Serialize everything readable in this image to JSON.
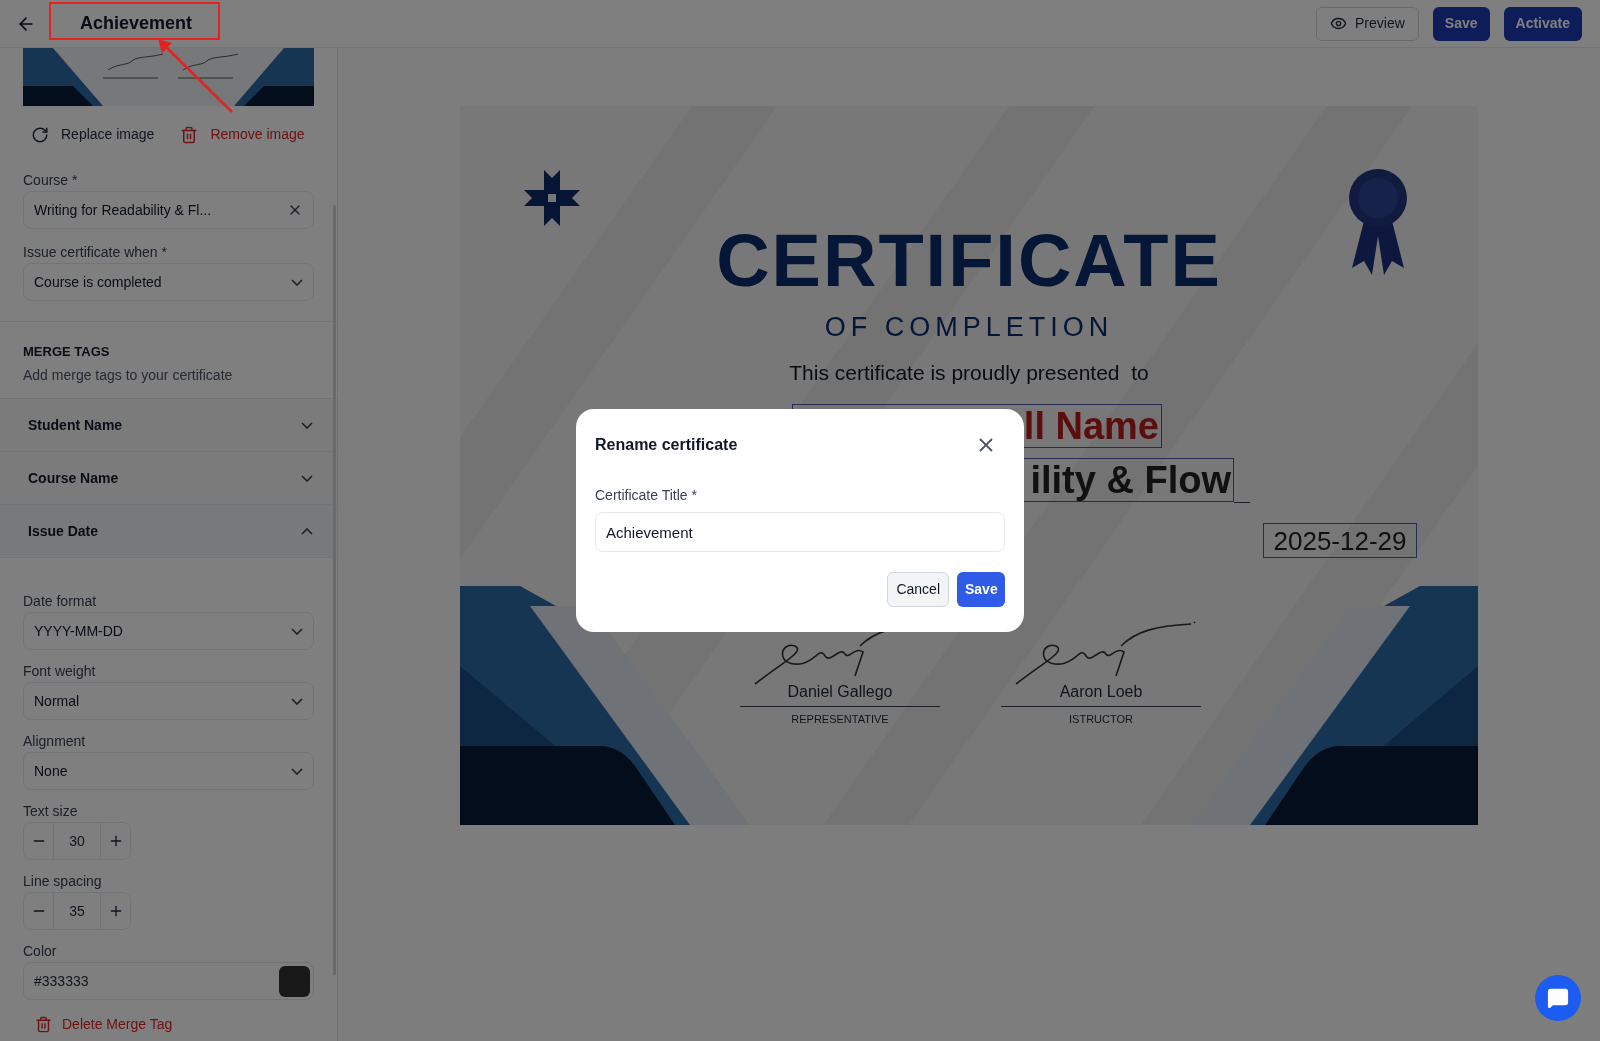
{
  "header": {
    "title": "Achievement",
    "actions": [
      {
        "label": "Preview",
        "kind": "outline"
      },
      {
        "label": "Save",
        "kind": "primary"
      },
      {
        "label": "Activate",
        "kind": "primary"
      }
    ]
  },
  "sidebar": {
    "image_actions": [
      {
        "label": "Replace image",
        "kind": "replace"
      },
      {
        "label": "Remove image",
        "kind": "remove"
      }
    ],
    "fields": [
      {
        "label": "Course *",
        "kind": "clearable",
        "value": "Writing for Readability & Fl..."
      },
      {
        "label": "Issue certificate when *",
        "kind": "select",
        "value": "Course is completed"
      }
    ],
    "merge_tags": {
      "title": "MERGE TAGS",
      "subtitle": "Add merge tags to your certificate",
      "items": [
        {
          "label": "Student Name",
          "expanded": false
        },
        {
          "label": "Course Name",
          "expanded": false
        },
        {
          "label": "Issue Date",
          "expanded": true,
          "settings": [
            {
              "label": "Date format",
              "kind": "select",
              "value": "YYYY-MM-DD"
            },
            {
              "label": "Font weight",
              "kind": "select",
              "value": "Normal"
            },
            {
              "label": "Alignment",
              "kind": "select",
              "value": "None"
            },
            {
              "label": "Text size",
              "kind": "stepper",
              "value": "30"
            },
            {
              "label": "Line spacing",
              "kind": "stepper",
              "value": "35"
            },
            {
              "label": "Color",
              "kind": "color",
              "value": "#333333"
            }
          ],
          "delete_label": "Delete Merge Tag"
        }
      ]
    }
  },
  "certificate": {
    "title": "CERTIFICATE",
    "subtitle": "OF COMPLETION",
    "presented": "This certificate is proudly presented  to",
    "student_name": "ll Name",
    "course_name": "ility & Flow",
    "issue_date": "2025-12-29",
    "signatures": [
      {
        "name": "Daniel Gallego",
        "role": "REPRESENTATIVE"
      },
      {
        "name": "Aaron Loeb",
        "role": "ISTRUCTOR"
      }
    ]
  },
  "dialog": {
    "title": "Rename certificate",
    "field_label": "Certificate Title *",
    "value": "Achievement",
    "buttons": [
      {
        "label": "Cancel",
        "kind": "secondary"
      },
      {
        "label": "Save",
        "kind": "primary"
      }
    ]
  }
}
